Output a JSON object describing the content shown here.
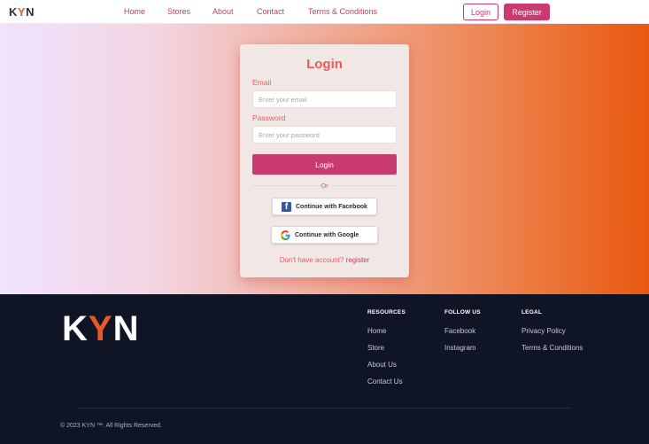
{
  "nav": {
    "logo_left": "K",
    "logo_mid": "Y",
    "logo_right": "N",
    "links": [
      "Home",
      "Stores",
      "About",
      "Contact",
      "Terms & Conditions"
    ],
    "login_label": "Login",
    "register_label": "Register"
  },
  "login_card": {
    "title": "Login",
    "email_label": "Email",
    "email_placeholder": "Enter your email",
    "password_label": "Password",
    "password_placeholder": "Enter your password",
    "submit_label": "Login",
    "or_text": "Or",
    "facebook_label": "Continue with Facebook",
    "google_label": "Continue with Google",
    "no_account_text": "Don't have account?",
    "register_link": "register"
  },
  "footer": {
    "logo_left": "K",
    "logo_mid": "Y",
    "logo_right": "N",
    "resources": {
      "heading": "RESOURCES",
      "links": [
        "Home",
        "Store",
        "About Us",
        "Contact Us"
      ]
    },
    "follow": {
      "heading": "FOLLOW US",
      "links": [
        "Facebook",
        "Instagram"
      ]
    },
    "legal": {
      "heading": "LEGAL",
      "links": [
        "Privacy Policy",
        "Terms & Conditions"
      ]
    },
    "copyright": "© 2023 KYN ™. All Rights Reserved."
  },
  "colors": {
    "accent": "#c93a6e",
    "brand_orange": "#e8592a",
    "title_red": "#ef5a5a",
    "footer_bg": "#0f1524"
  },
  "icons": {
    "facebook": "facebook-icon",
    "google": "google-icon"
  }
}
